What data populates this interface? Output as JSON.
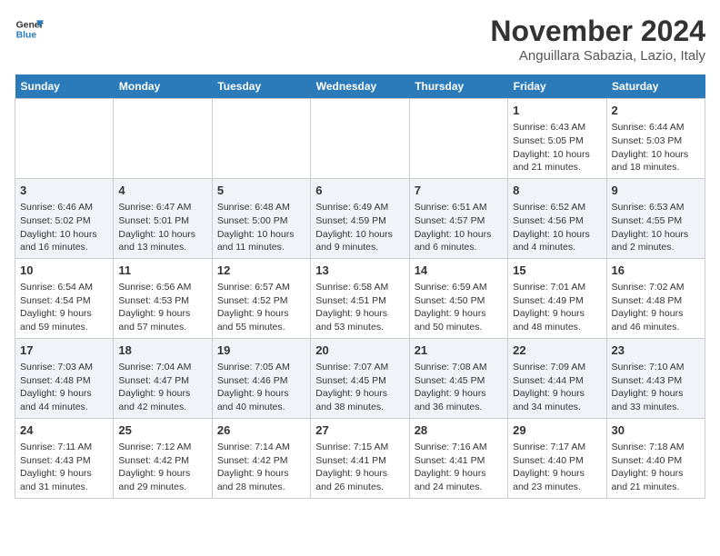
{
  "header": {
    "logo_line1": "General",
    "logo_line2": "Blue",
    "month": "November 2024",
    "location": "Anguillara Sabazia, Lazio, Italy"
  },
  "days_of_week": [
    "Sunday",
    "Monday",
    "Tuesday",
    "Wednesday",
    "Thursday",
    "Friday",
    "Saturday"
  ],
  "weeks": [
    [
      {
        "day": "",
        "info": ""
      },
      {
        "day": "",
        "info": ""
      },
      {
        "day": "",
        "info": ""
      },
      {
        "day": "",
        "info": ""
      },
      {
        "day": "",
        "info": ""
      },
      {
        "day": "1",
        "info": "Sunrise: 6:43 AM\nSunset: 5:05 PM\nDaylight: 10 hours\nand 21 minutes."
      },
      {
        "day": "2",
        "info": "Sunrise: 6:44 AM\nSunset: 5:03 PM\nDaylight: 10 hours\nand 18 minutes."
      }
    ],
    [
      {
        "day": "3",
        "info": "Sunrise: 6:46 AM\nSunset: 5:02 PM\nDaylight: 10 hours\nand 16 minutes."
      },
      {
        "day": "4",
        "info": "Sunrise: 6:47 AM\nSunset: 5:01 PM\nDaylight: 10 hours\nand 13 minutes."
      },
      {
        "day": "5",
        "info": "Sunrise: 6:48 AM\nSunset: 5:00 PM\nDaylight: 10 hours\nand 11 minutes."
      },
      {
        "day": "6",
        "info": "Sunrise: 6:49 AM\nSunset: 4:59 PM\nDaylight: 10 hours\nand 9 minutes."
      },
      {
        "day": "7",
        "info": "Sunrise: 6:51 AM\nSunset: 4:57 PM\nDaylight: 10 hours\nand 6 minutes."
      },
      {
        "day": "8",
        "info": "Sunrise: 6:52 AM\nSunset: 4:56 PM\nDaylight: 10 hours\nand 4 minutes."
      },
      {
        "day": "9",
        "info": "Sunrise: 6:53 AM\nSunset: 4:55 PM\nDaylight: 10 hours\nand 2 minutes."
      }
    ],
    [
      {
        "day": "10",
        "info": "Sunrise: 6:54 AM\nSunset: 4:54 PM\nDaylight: 9 hours\nand 59 minutes."
      },
      {
        "day": "11",
        "info": "Sunrise: 6:56 AM\nSunset: 4:53 PM\nDaylight: 9 hours\nand 57 minutes."
      },
      {
        "day": "12",
        "info": "Sunrise: 6:57 AM\nSunset: 4:52 PM\nDaylight: 9 hours\nand 55 minutes."
      },
      {
        "day": "13",
        "info": "Sunrise: 6:58 AM\nSunset: 4:51 PM\nDaylight: 9 hours\nand 53 minutes."
      },
      {
        "day": "14",
        "info": "Sunrise: 6:59 AM\nSunset: 4:50 PM\nDaylight: 9 hours\nand 50 minutes."
      },
      {
        "day": "15",
        "info": "Sunrise: 7:01 AM\nSunset: 4:49 PM\nDaylight: 9 hours\nand 48 minutes."
      },
      {
        "day": "16",
        "info": "Sunrise: 7:02 AM\nSunset: 4:48 PM\nDaylight: 9 hours\nand 46 minutes."
      }
    ],
    [
      {
        "day": "17",
        "info": "Sunrise: 7:03 AM\nSunset: 4:48 PM\nDaylight: 9 hours\nand 44 minutes."
      },
      {
        "day": "18",
        "info": "Sunrise: 7:04 AM\nSunset: 4:47 PM\nDaylight: 9 hours\nand 42 minutes."
      },
      {
        "day": "19",
        "info": "Sunrise: 7:05 AM\nSunset: 4:46 PM\nDaylight: 9 hours\nand 40 minutes."
      },
      {
        "day": "20",
        "info": "Sunrise: 7:07 AM\nSunset: 4:45 PM\nDaylight: 9 hours\nand 38 minutes."
      },
      {
        "day": "21",
        "info": "Sunrise: 7:08 AM\nSunset: 4:45 PM\nDaylight: 9 hours\nand 36 minutes."
      },
      {
        "day": "22",
        "info": "Sunrise: 7:09 AM\nSunset: 4:44 PM\nDaylight: 9 hours\nand 34 minutes."
      },
      {
        "day": "23",
        "info": "Sunrise: 7:10 AM\nSunset: 4:43 PM\nDaylight: 9 hours\nand 33 minutes."
      }
    ],
    [
      {
        "day": "24",
        "info": "Sunrise: 7:11 AM\nSunset: 4:43 PM\nDaylight: 9 hours\nand 31 minutes."
      },
      {
        "day": "25",
        "info": "Sunrise: 7:12 AM\nSunset: 4:42 PM\nDaylight: 9 hours\nand 29 minutes."
      },
      {
        "day": "26",
        "info": "Sunrise: 7:14 AM\nSunset: 4:42 PM\nDaylight: 9 hours\nand 28 minutes."
      },
      {
        "day": "27",
        "info": "Sunrise: 7:15 AM\nSunset: 4:41 PM\nDaylight: 9 hours\nand 26 minutes."
      },
      {
        "day": "28",
        "info": "Sunrise: 7:16 AM\nSunset: 4:41 PM\nDaylight: 9 hours\nand 24 minutes."
      },
      {
        "day": "29",
        "info": "Sunrise: 7:17 AM\nSunset: 4:40 PM\nDaylight: 9 hours\nand 23 minutes."
      },
      {
        "day": "30",
        "info": "Sunrise: 7:18 AM\nSunset: 4:40 PM\nDaylight: 9 hours\nand 21 minutes."
      }
    ]
  ]
}
